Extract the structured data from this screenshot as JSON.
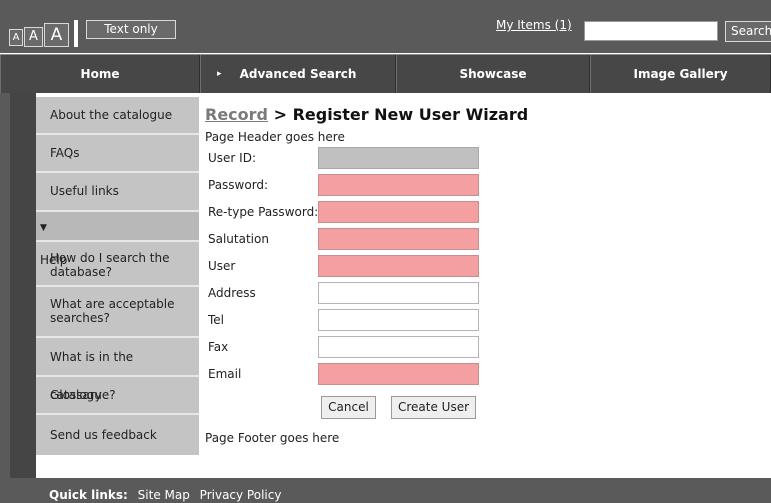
{
  "topbar": {
    "font_small": "A",
    "font_medium": "A",
    "font_large": "A",
    "text_only": "Text only",
    "my_items": "My Items (1)",
    "search_value": "",
    "search_button": "Search"
  },
  "nav": {
    "items": [
      {
        "label": "Home"
      },
      {
        "label": "Advanced Search"
      },
      {
        "label": "Showcase"
      },
      {
        "label": "Image Gallery"
      }
    ],
    "arrow": "▸"
  },
  "sidebar": {
    "items": [
      {
        "label": "About the catalogue"
      },
      {
        "label": "FAQs"
      },
      {
        "label": "Useful links"
      },
      {
        "label": "Help"
      },
      {
        "label": "How do I search the database?"
      },
      {
        "label": "What are acceptable searches?"
      },
      {
        "label": "What is in the catalogue?"
      },
      {
        "label": "Glossary"
      },
      {
        "label": "Send us feedback"
      }
    ],
    "help_toggle": "▼"
  },
  "main": {
    "breadcrumb_link": "Record",
    "breadcrumb_sep": ">",
    "title": "Register New User Wizard",
    "header_note": "Page Header goes here",
    "footer_note": "Page Footer goes here",
    "fields": [
      {
        "label": "User ID:",
        "value": "",
        "state": "disabled"
      },
      {
        "label": "Password:",
        "value": "",
        "state": "required"
      },
      {
        "label": "Re-type Password:",
        "value": "",
        "state": "required"
      },
      {
        "label": "Salutation",
        "value": "",
        "state": "required"
      },
      {
        "label": "User",
        "value": "",
        "state": "required"
      },
      {
        "label": "Address",
        "value": "",
        "state": "optional"
      },
      {
        "label": "Tel",
        "value": "",
        "state": "optional"
      },
      {
        "label": "Fax",
        "value": "",
        "state": "optional"
      },
      {
        "label": "Email",
        "value": "",
        "state": "required"
      }
    ],
    "cancel_button": "Cancel",
    "create_button": "Create User"
  },
  "footer": {
    "quick_links_label": "Quick links:",
    "links": [
      {
        "label": "Site Map"
      },
      {
        "label": "Privacy Policy"
      }
    ]
  },
  "colors": {
    "required_field": "#f5a0a0",
    "disabled_field": "#c0c0c0",
    "top_bar": "#5a5a5a",
    "nav_bar": "#474747",
    "sidebar_item": "#c4c4c4"
  }
}
